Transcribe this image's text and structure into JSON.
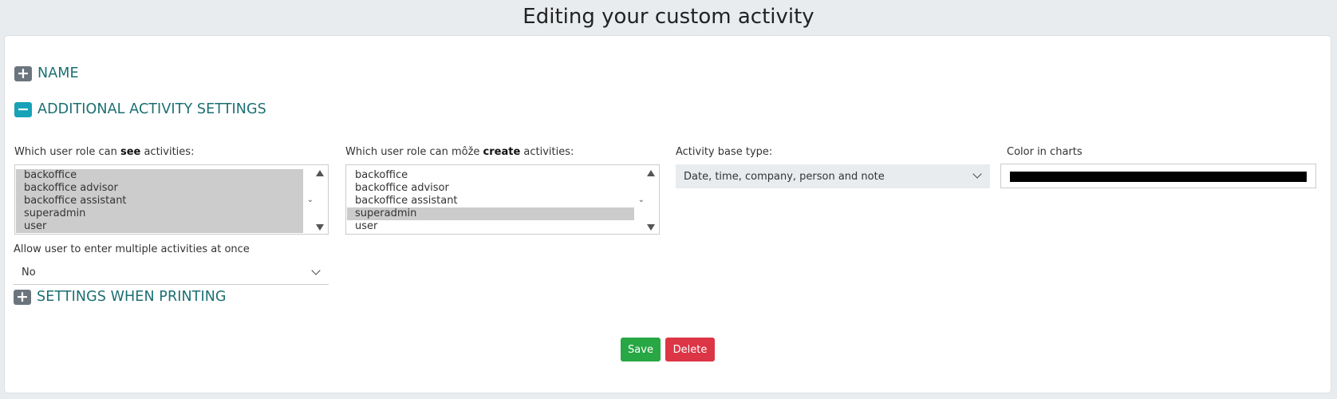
{
  "page_title": "Editing your custom activity",
  "sections": {
    "name": {
      "label": "NAME",
      "toggle": "+"
    },
    "additional": {
      "label": "ADDITIONAL ACTIVITY SETTINGS",
      "toggle": "−"
    },
    "printing": {
      "label": "SETTINGS WHEN PRINTING",
      "toggle": "+"
    }
  },
  "see_roles": {
    "label_prefix": "Which user role can ",
    "label_bold": "see",
    "label_suffix": " activities:",
    "options": [
      "backoffice",
      "backoffice advisor",
      "backoffice assistant",
      "superadmin",
      "user"
    ],
    "selected": [
      "backoffice",
      "backoffice advisor",
      "backoffice assistant",
      "superadmin",
      "user"
    ]
  },
  "create_roles": {
    "label_prefix": "Which user role can môže ",
    "label_bold": "create",
    "label_suffix": " activities:",
    "options": [
      "backoffice",
      "backoffice advisor",
      "backoffice assistant",
      "superadmin",
      "user"
    ],
    "selected": [
      "superadmin"
    ]
  },
  "base_type": {
    "label": "Activity base type:",
    "value": "Date, time, company, person and note"
  },
  "chart_color": {
    "label": "Color in charts",
    "value": "#000000"
  },
  "multiple": {
    "label": "Allow user to enter multiple activities at once",
    "value": "No"
  },
  "buttons": {
    "save": "Save",
    "delete": "Delete"
  },
  "colors": {
    "teal": "#17a2b8",
    "heading": "#1b6f72",
    "save": "#28a745",
    "delete": "#dc3545"
  }
}
